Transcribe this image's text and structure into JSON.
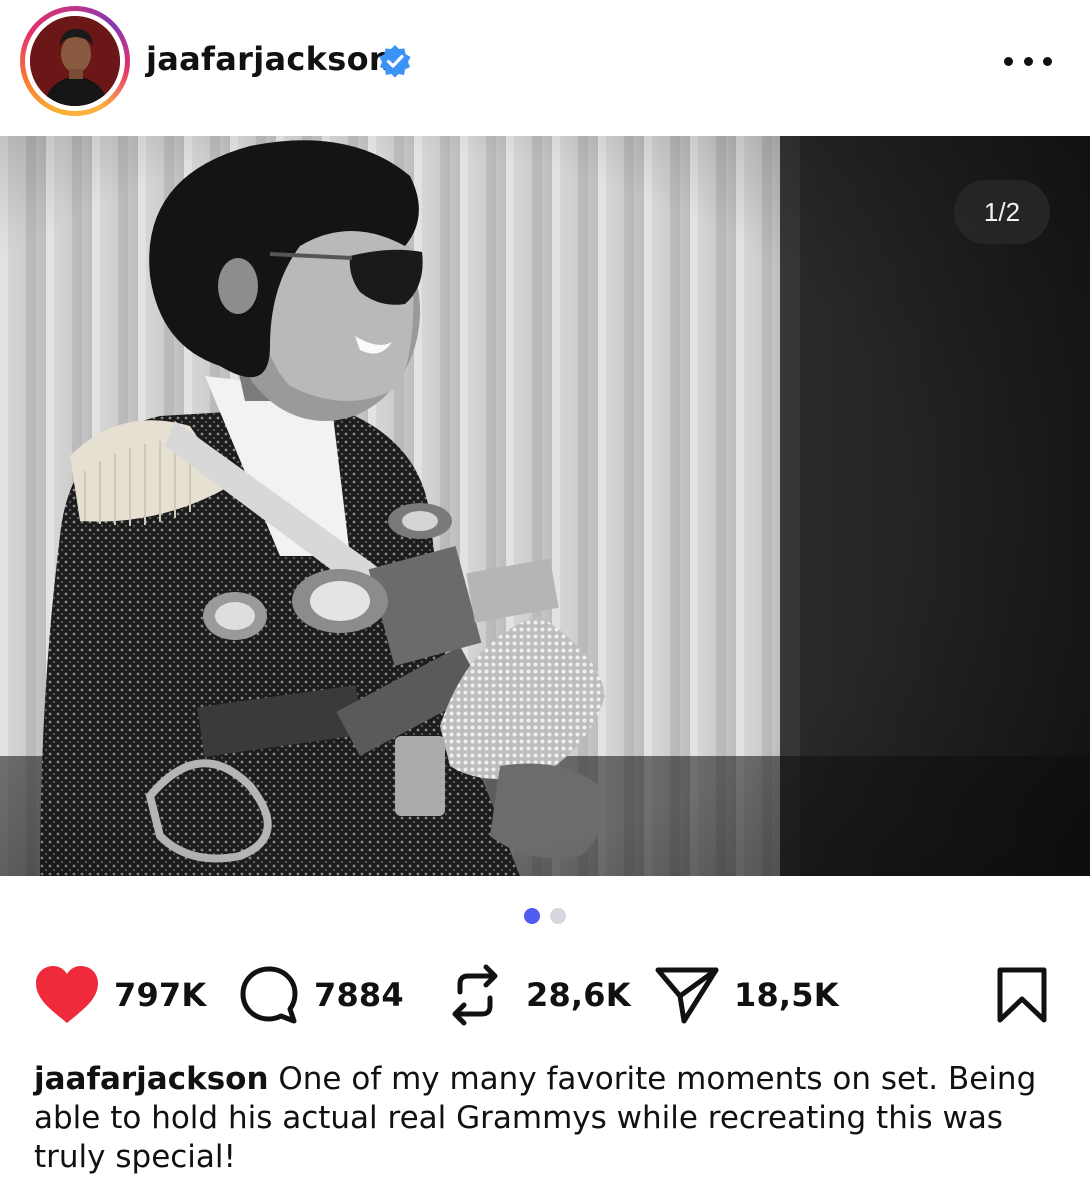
{
  "post": {
    "username": "jaafarjackson",
    "verified": true,
    "page_counter": "1/2",
    "carousel": {
      "total": 2,
      "current": 1
    },
    "likes": "797K",
    "comments": "7884",
    "reposts": "28,6K",
    "shares": "18,5K",
    "caption_username": "jaafarjackson",
    "caption_text": "One of my many favorite moments on set. Being able to hold his actual real Grammys while recreating this was truly special!"
  },
  "icons": {
    "more": "more-horizontal-icon",
    "like": "heart-filled-icon",
    "comment": "comment-bubble-icon",
    "repost": "repost-arrows-icon",
    "share": "paper-plane-icon",
    "save": "bookmark-icon",
    "verified": "verified-badge-icon"
  },
  "colors": {
    "like_red": "#ee2a3b",
    "verified_blue": "#3b93f5",
    "active_dot": "#4f5cf0",
    "inactive_dot": "#d6d6de"
  }
}
